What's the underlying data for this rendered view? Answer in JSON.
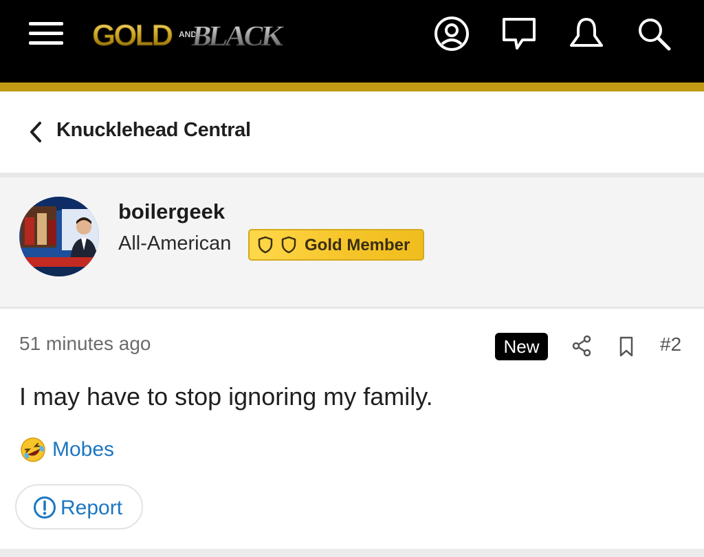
{
  "header": {
    "logo_text": "GOLD AND BLACK",
    "icons": [
      "menu-icon",
      "account-icon",
      "messages-icon",
      "alerts-icon",
      "search-icon"
    ],
    "bar_color": "#000000",
    "accent_color": "#c29b16"
  },
  "breadcrumb": {
    "label": "Knucklehead Central",
    "icon": "chevron-left-icon"
  },
  "user": {
    "name": "boilergeek",
    "title": "All-American",
    "badge_label": "Gold Member",
    "badge_color": "#f6c52a"
  },
  "post": {
    "time": "51 minutes ago",
    "new_label": "New",
    "number": "#2",
    "body": "I may have to stop ignoring my family.",
    "reaction_name": "Mobes",
    "reaction_emoji": "rofl-emoji",
    "report_label": "Report",
    "link_color": "#1b76c2"
  }
}
